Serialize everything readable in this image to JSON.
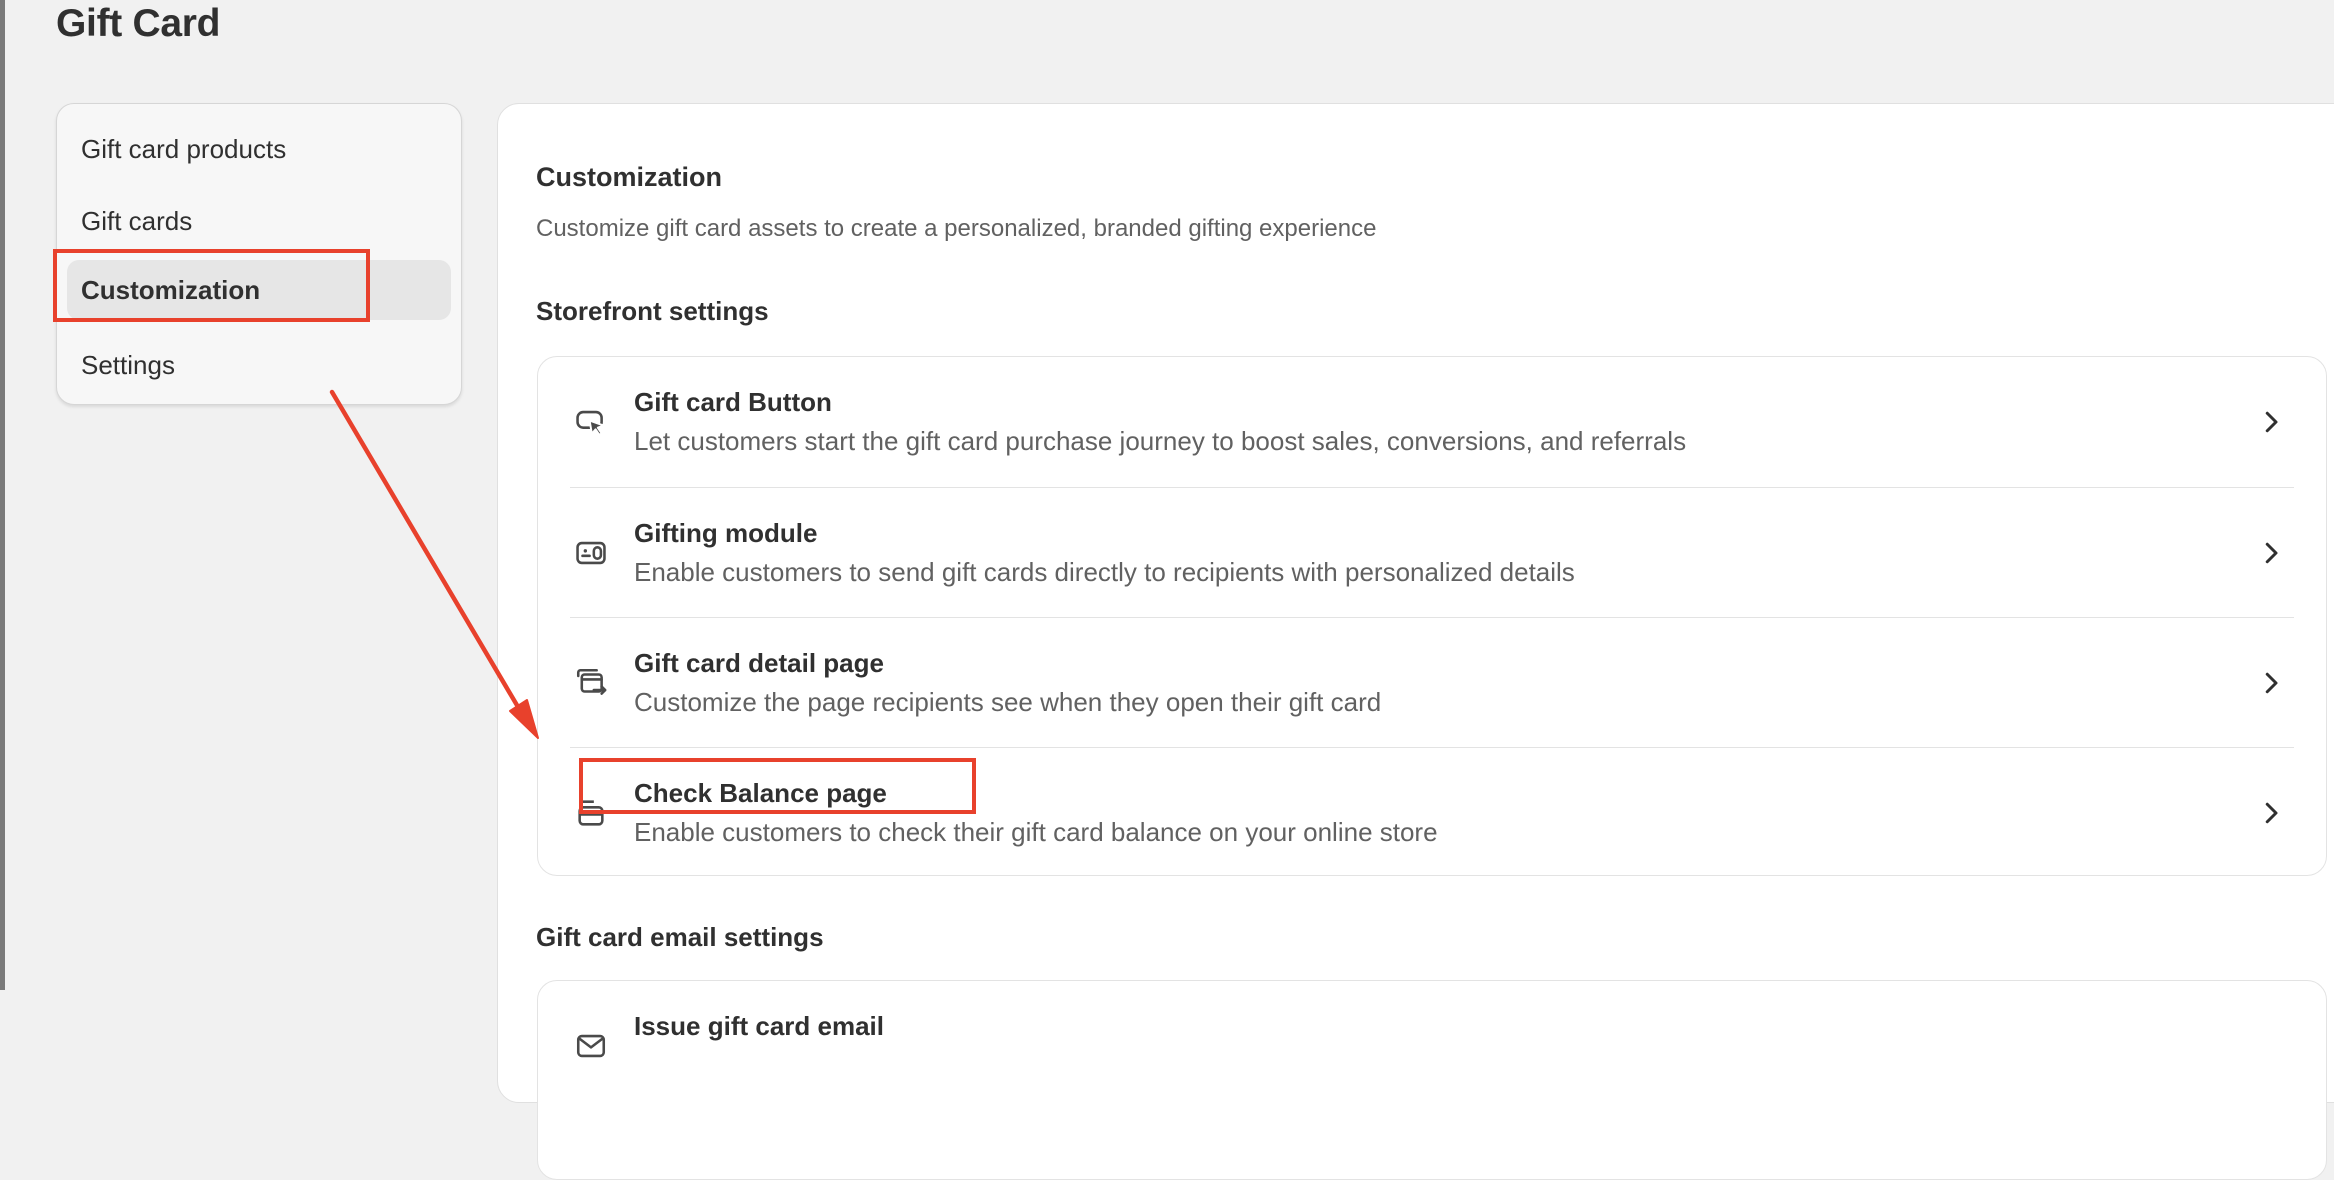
{
  "page": {
    "title": "Gift Card"
  },
  "sidebar": {
    "items": [
      {
        "label": "Gift card products",
        "active": false
      },
      {
        "label": "Gift cards",
        "active": false
      },
      {
        "label": "Customization",
        "active": true
      },
      {
        "label": "Settings",
        "active": false
      }
    ]
  },
  "main": {
    "title": "Customization",
    "description": "Customize gift card assets to create a personalized, branded gifting experience",
    "storefront": {
      "heading": "Storefront settings",
      "rows": [
        {
          "icon": "cursor-click-icon",
          "title": "Gift card Button",
          "description": "Let customers start the gift card purchase journey to boost sales, conversions, and referrals"
        },
        {
          "icon": "gift-module-icon",
          "title": "Gifting module",
          "description": "Enable customers to send gift cards directly to recipients with personalized details"
        },
        {
          "icon": "page-detail-icon",
          "title": "Gift card detail page",
          "description": "Customize the page recipients see when they open their gift card"
        },
        {
          "icon": "wallet-icon",
          "title": "Check Balance page",
          "description": "Enable customers to check their gift card balance on your online store"
        }
      ]
    },
    "email": {
      "heading": "Gift card email settings",
      "rows": [
        {
          "icon": "email-icon",
          "title": "Issue gift card email"
        }
      ]
    }
  },
  "annotations": {
    "color": "#e8412c"
  }
}
